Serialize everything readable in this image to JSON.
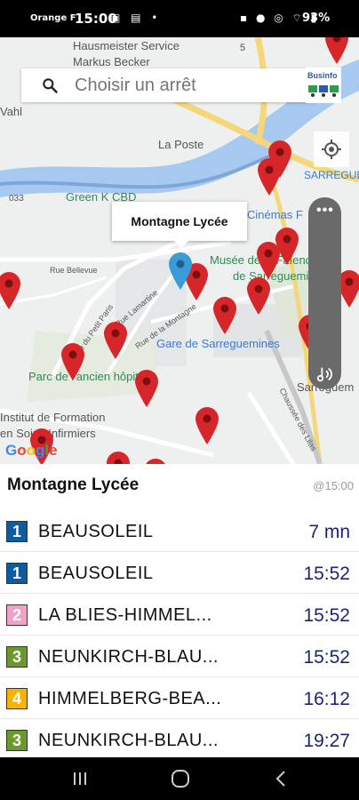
{
  "status_bar": {
    "carrier": "Orange F",
    "time": "15:00",
    "battery": "93%"
  },
  "map": {
    "search": {
      "placeholder": "Choisir un arrêt"
    },
    "logo_text": "Businfo",
    "callout": "Montagne Lycée",
    "labels": {
      "hausmeister_1": "Hausmeister Service",
      "hausmeister_2": "Markus Becker",
      "vahl": "Vahl",
      "la_poste": "La Poste",
      "green_cbd": "Green K CBD",
      "cinemas": "Cinémas F",
      "rue_belleve": "Rue Bellevue",
      "musee_1": "Musée de la Faïence",
      "musee_2": "de Sarreguemines",
      "gare": "Gare de Sarreguemines",
      "parc": "Parc de l'ancien hôpital",
      "institut_1": "Institut de Formation",
      "institut_2": "en Soins Infirmiers",
      "sarreg": "Sarreguem",
      "sarreg_city": "SARREGUE",
      "num_5": "5",
      "num_033": "033",
      "rue_montagne": "Rue de la Montagne",
      "rue_petit_paris": "Rue du Petit Paris",
      "rue_lamartine": "Rue Lamartine",
      "chaussee": "Chaussée des Lilas"
    },
    "google_logo": [
      "G",
      "o",
      "o",
      "g",
      "l",
      "e"
    ]
  },
  "stop": {
    "name": "Montagne Lycée",
    "updated": "@15:00"
  },
  "departures": [
    {
      "line": "1",
      "color": "#0d5ba0",
      "destination": "BEAUSOLEIL",
      "time": "7 mn"
    },
    {
      "line": "1",
      "color": "#0d5ba0",
      "destination": "BEAUSOLEIL",
      "time": "15:52"
    },
    {
      "line": "2",
      "color": "#f2a2c6",
      "destination": "LA BLIES-HIMMEL...",
      "time": "15:52"
    },
    {
      "line": "3",
      "color": "#6a9a2b",
      "destination": "NEUNKIRCH-BLAU...",
      "time": "15:52"
    },
    {
      "line": "4",
      "color": "#f5b400",
      "destination": "HIMMELBERG-BEA...",
      "time": "16:12"
    },
    {
      "line": "3",
      "color": "#6a9a2b",
      "destination": "NEUNKIRCH-BLAU...",
      "time": "19:27"
    }
  ]
}
